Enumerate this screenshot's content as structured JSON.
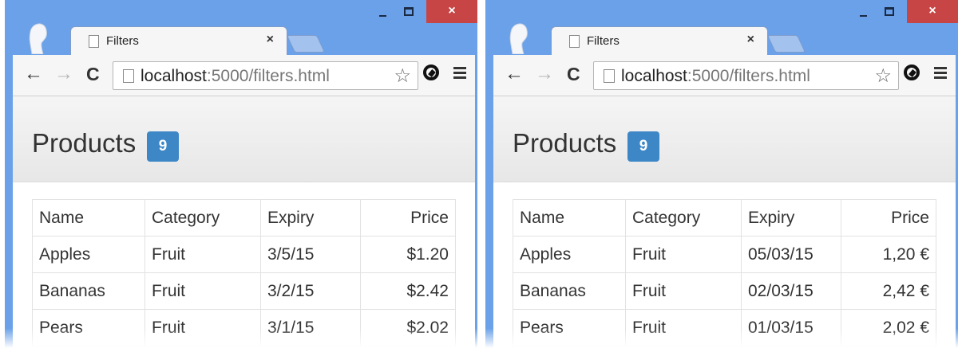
{
  "windows": [
    {
      "tab_title": "Filters",
      "tab_close": "×",
      "url_host": "localhost",
      "url_rest": ":5000/filters.html",
      "products_title": "Products",
      "product_count": "9",
      "columns": [
        "Name",
        "Category",
        "Expiry",
        "Price"
      ],
      "rows": [
        [
          "Apples",
          "Fruit",
          "3/5/15",
          "$1.20"
        ],
        [
          "Bananas",
          "Fruit",
          "3/2/15",
          "$2.42"
        ],
        [
          "Pears",
          "Fruit",
          "3/1/15",
          "$2.02"
        ]
      ]
    },
    {
      "tab_title": "Filters",
      "tab_close": "×",
      "url_host": "localhost",
      "url_rest": ":5000/filters.html",
      "products_title": "Products",
      "product_count": "9",
      "columns": [
        "Name",
        "Category",
        "Expiry",
        "Price"
      ],
      "rows": [
        [
          "Apples",
          "Fruit",
          "05/03/15",
          "1,20 €"
        ],
        [
          "Bananas",
          "Fruit",
          "02/03/15",
          "2,42 €"
        ],
        [
          "Pears",
          "Fruit",
          "01/03/15",
          "2,02 €"
        ]
      ]
    }
  ],
  "icons": {
    "back": "←",
    "forward": "→",
    "reload": "C",
    "star": "☆",
    "close": "×"
  },
  "colors": {
    "title_bar": "#6aa1e8",
    "close_button": "#c74545",
    "badge": "#3d87c6"
  }
}
